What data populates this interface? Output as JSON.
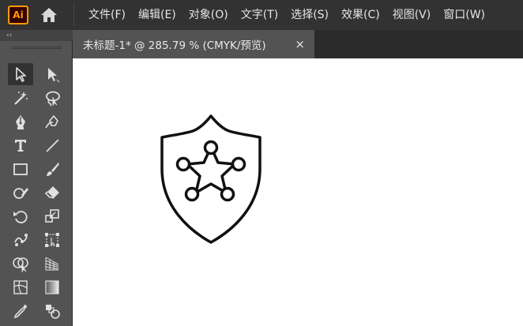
{
  "app": {
    "logo_text": "Ai",
    "logo_color": "#ff9a00",
    "home_icon": "home-icon"
  },
  "menu": {
    "items": [
      {
        "label": "文件(F)"
      },
      {
        "label": "编辑(E)"
      },
      {
        "label": "对象(O)"
      },
      {
        "label": "文字(T)"
      },
      {
        "label": "选择(S)"
      },
      {
        "label": "效果(C)"
      },
      {
        "label": "视图(V)"
      },
      {
        "label": "窗口(W)"
      }
    ]
  },
  "tools_panel": {
    "collapse_glyph": "‹‹",
    "tools": [
      {
        "name": "selection-tool-icon",
        "selected": true
      },
      {
        "name": "direct-selection-tool-icon"
      },
      {
        "name": "magic-wand-tool-icon"
      },
      {
        "name": "lasso-tool-icon"
      },
      {
        "name": "pen-tool-icon"
      },
      {
        "name": "curvature-tool-icon"
      },
      {
        "name": "type-tool-icon"
      },
      {
        "name": "line-segment-tool-icon"
      },
      {
        "name": "rectangle-tool-icon"
      },
      {
        "name": "paintbrush-tool-icon"
      },
      {
        "name": "shaper-tool-icon"
      },
      {
        "name": "eraser-tool-icon"
      },
      {
        "name": "rotate-tool-icon"
      },
      {
        "name": "scale-tool-icon"
      },
      {
        "name": "puppet-warp-tool-icon"
      },
      {
        "name": "free-transform-tool-icon"
      },
      {
        "name": "shape-builder-tool-icon"
      },
      {
        "name": "perspective-grid-tool-icon"
      },
      {
        "name": "mesh-tool-icon"
      },
      {
        "name": "gradient-tool-icon"
      },
      {
        "name": "eyedropper-tool-icon"
      },
      {
        "name": "blend-tool-icon"
      }
    ]
  },
  "document": {
    "tab_title": "未标题-1* @ 285.79 % (CMYK/预览)",
    "close_glyph": "×"
  },
  "artwork": {
    "name": "sheriff-shield-star-icon",
    "stroke_color": "#111111"
  }
}
